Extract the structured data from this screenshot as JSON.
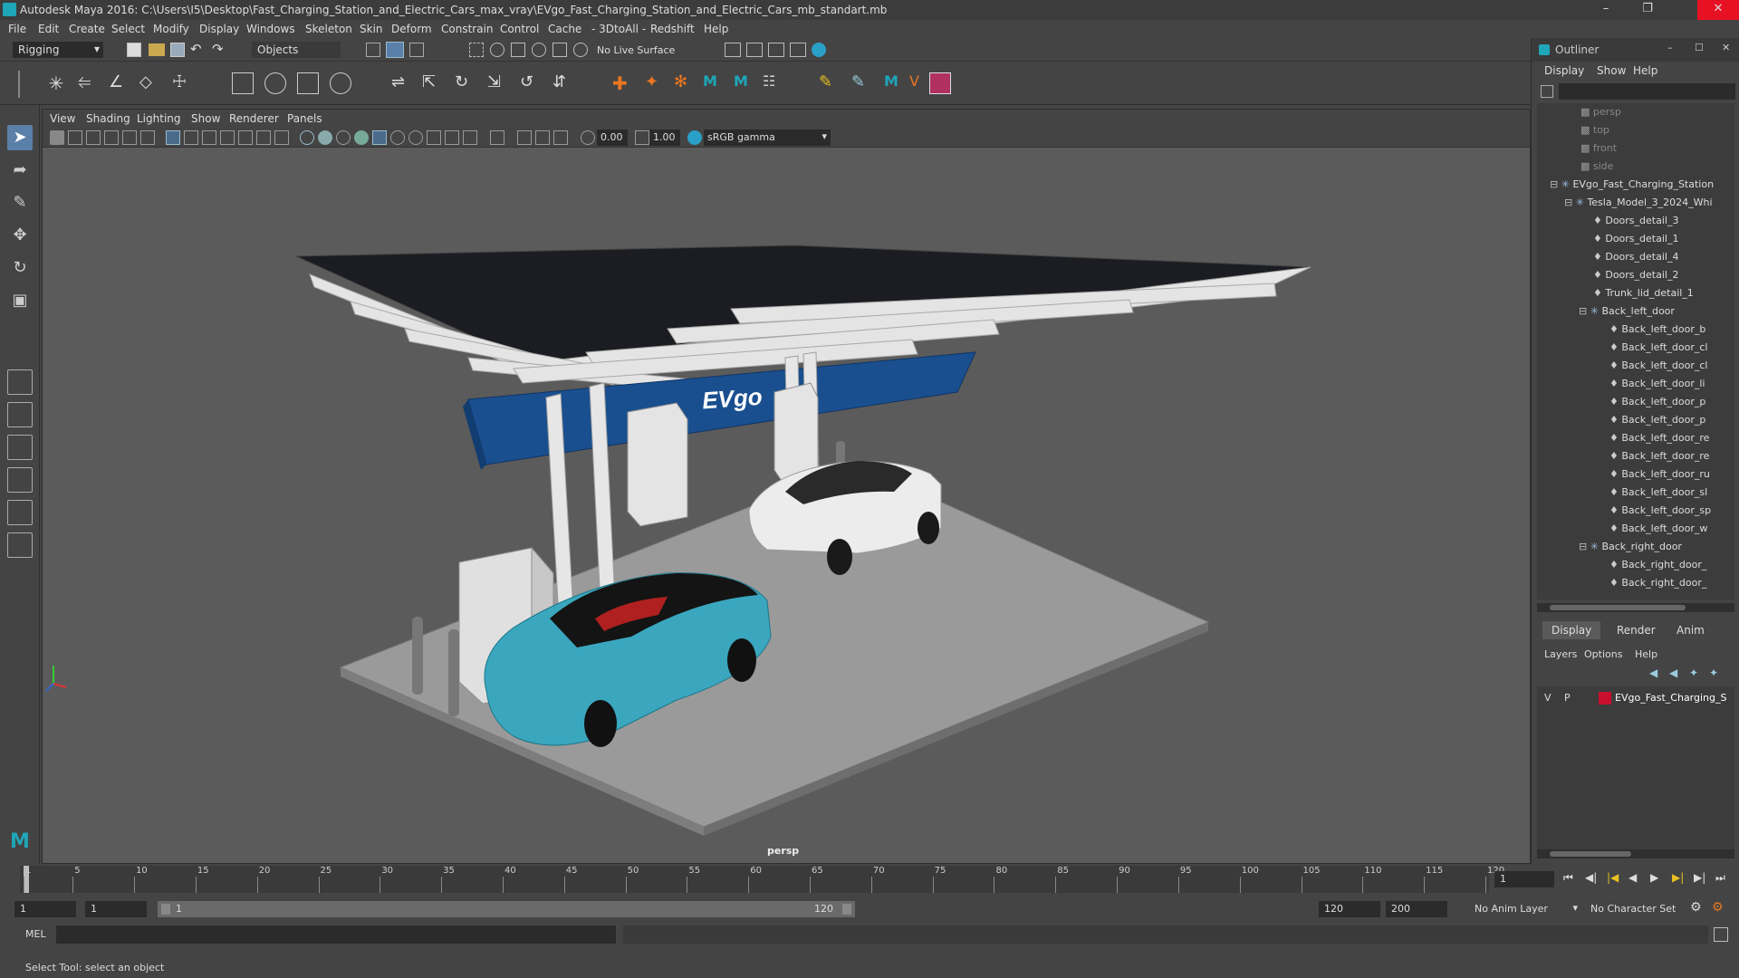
{
  "window": {
    "title": "Autodesk Maya 2016: C:\\Users\\I5\\Desktop\\Fast_Charging_Station_and_Electric_Cars_max_vray\\EVgo_Fast_Charging_Station_and_Electric_Cars_mb_standart.mb"
  },
  "menubar": {
    "items": [
      "File",
      "Edit",
      "Create",
      "Select",
      "Modify",
      "Display",
      "Windows",
      "Skeleton",
      "Skin",
      "Deform",
      "Constrain",
      "Control",
      "Cache",
      "- 3DtoAll -",
      "Redshift",
      "Help"
    ]
  },
  "statusline": {
    "mode": "Rigging",
    "select_mode": "Objects",
    "live_surface": "No Live Surface"
  },
  "viewport": {
    "menu": [
      "View",
      "Shading",
      "Lighting",
      "Show",
      "Renderer",
      "Panels"
    ],
    "exposure": "0.00",
    "gamma": "1.00",
    "color_space": "sRGB gamma",
    "camera_label": "persp",
    "scene_sign": "EVgo"
  },
  "outliner": {
    "title": "Outliner",
    "menu": [
      "Display",
      "Show",
      "Help"
    ],
    "items": [
      {
        "label": "persp",
        "dim": true
      },
      {
        "label": "top",
        "dim": true
      },
      {
        "label": "front",
        "dim": true
      },
      {
        "label": "side",
        "dim": true
      },
      {
        "label": "EVgo_Fast_Charging_Station",
        "dim": false
      },
      {
        "label": "Tesla_Model_3_2024_Whi",
        "dim": false
      },
      {
        "label": "Doors_detail_3",
        "dim": false
      },
      {
        "label": "Doors_detail_1",
        "dim": false
      },
      {
        "label": "Doors_detail_4",
        "dim": false
      },
      {
        "label": "Doors_detail_2",
        "dim": false
      },
      {
        "label": "Trunk_lid_detail_1",
        "dim": false
      },
      {
        "label": "Back_left_door",
        "dim": false
      },
      {
        "label": "Back_left_door_b",
        "dim": false
      },
      {
        "label": "Back_left_door_cl",
        "dim": false
      },
      {
        "label": "Back_left_door_cl",
        "dim": false
      },
      {
        "label": "Back_left_door_li",
        "dim": false
      },
      {
        "label": "Back_left_door_p",
        "dim": false
      },
      {
        "label": "Back_left_door_p",
        "dim": false
      },
      {
        "label": "Back_left_door_re",
        "dim": false
      },
      {
        "label": "Back_left_door_re",
        "dim": false
      },
      {
        "label": "Back_left_door_ru",
        "dim": false
      },
      {
        "label": "Back_left_door_sl",
        "dim": false
      },
      {
        "label": "Back_left_door_sp",
        "dim": false
      },
      {
        "label": "Back_left_door_w",
        "dim": false
      },
      {
        "label": "Back_right_door",
        "dim": false
      },
      {
        "label": "Back_right_door_",
        "dim": false
      },
      {
        "label": "Back_right_door_",
        "dim": false
      }
    ]
  },
  "layers": {
    "tabs": [
      "Display",
      "Render",
      "Anim"
    ],
    "menu": [
      "Layers",
      "Options",
      "Help"
    ],
    "layer": {
      "v": "V",
      "p": "P",
      "name": "EVgo_Fast_Charging_S",
      "color": "#c8102e"
    }
  },
  "timeline": {
    "ticks": [
      "1",
      "5",
      "10",
      "15",
      "20",
      "25",
      "30",
      "35",
      "40",
      "45",
      "50",
      "55",
      "60",
      "65",
      "70",
      "75",
      "80",
      "85",
      "90",
      "95",
      "100",
      "105",
      "110",
      "115",
      "120"
    ],
    "current_frame": "1"
  },
  "range": {
    "start": "1",
    "anim_start": "1",
    "slider_start": "1",
    "slider_end": "120",
    "anim_end": "120",
    "end": "200",
    "anim_layer": "No Anim Layer",
    "character_set": "No Character Set"
  },
  "command": {
    "label": "MEL"
  },
  "helpline": {
    "text": "Select Tool: select an object"
  },
  "colors": {
    "evgo_blue": "#1a4f8f",
    "teal_car": "#3aa7bf",
    "white_car": "#e8e8e8",
    "accent": "#3a8dde"
  }
}
